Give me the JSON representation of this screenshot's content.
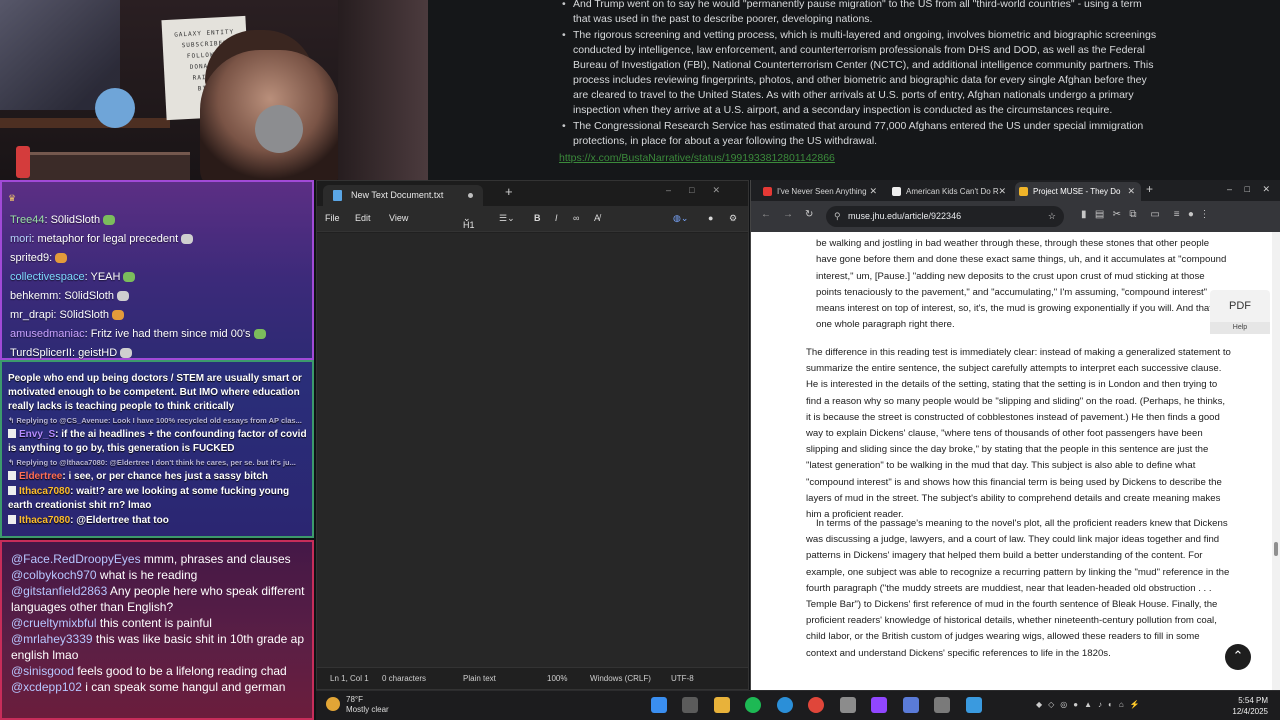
{
  "article_top": {
    "bullets": [
      "And Trump went on to say he would \"permanently pause migration\" to the US from all \"third-world countries\" - using a term that was used in the past to describe poorer, developing nations.",
      "The rigorous screening and vetting process, which is multi-layered and ongoing, involves biometric and biographic screenings conducted by intelligence, law enforcement, and counterterrorism professionals from DHS and DOD, as well as the Federal Bureau of Investigation (FBI), National Counterterrorism Center (NCTC), and additional intelligence community partners. This process includes reviewing fingerprints, photos, and other biometric and biographic data for every single Afghan before they are cleared to travel to the United States. As with other arrivals at U.S. ports of entry, Afghan nationals undergo a primary inspection when they arrive at a U.S. airport, and a secondary inspection is conducted as the circumstances require.",
      "The Congressional Research Service has estimated that around 77,000 Afghans entered the US under special immigration protections, in place for about a year following the US withdrawal."
    ],
    "link": "https://x.com/BustaNarrative/status/1991933812801142866"
  },
  "chat_top": [
    {
      "user": "Tree44",
      "text": ": S0lidSloth",
      "color": "#9be0a8"
    },
    {
      "user": "mori",
      "text": ": metaphor for legal precedent",
      "color": "#b9d5ff"
    },
    {
      "user": "sprited9",
      "text": ":",
      "color": "#ffffff"
    },
    {
      "user": "collectivespace",
      "text": ": YEAH",
      "color": "#7fd9ff"
    },
    {
      "user": "behkemm",
      "text": ": S0lidSloth",
      "color": "#ffffff"
    },
    {
      "user": "mr_drapi",
      "text": ": S0lidSloth",
      "color": "#ffffff"
    },
    {
      "user": "amusedmaniac",
      "text": ": Fritz ive had them since mid 00's",
      "color": "#c9a3ff"
    },
    {
      "user": "TurdSplicerII",
      "text": ": geistHD",
      "color": "#ffffff"
    }
  ],
  "chat_mid": {
    "first": "People who end up being doctors / STEM are usually smart or motivated enough to be competent. But IMO where education really lacks is teaching people to think critically",
    "reply1": "Replying to @CS_Avenue: Look I have 100% recycled old essays from AP clas...",
    "msg1_user": "Envy_S",
    "msg1_text": ": if the ai headlines + the confounding factor of covid is anything to go by, this generation is FUCKED",
    "reply2": "Replying to @lthaca7080: @Eldertree I don't think he cares, per se. but it's ju...",
    "msg2_user": "Eldertree",
    "msg2_text": ": i see, or per chance hes just a sassy bitch",
    "msg3_user": "Ithaca7080",
    "msg3_text": ": wait!? are we looking at some fucking young earth creationist shit rn? lmao",
    "msg4_user": "Ithaca7080",
    "msg4_text": ": @Eldertree that too"
  },
  "chat_bot": [
    {
      "user": "@Face.RedDroopyEyes",
      "text": " mmm, phrases and clauses"
    },
    {
      "user": "@colbykoch970",
      "text": " what is he reading"
    },
    {
      "user": "@gitstanfield2863",
      "text": " Any people here who speak different languages other than English?"
    },
    {
      "user": "@crueltymixbful",
      "text": " this content is painful"
    },
    {
      "user": "@mrlahey3339",
      "text": " this was like basic shit in 10th grade ap english lmao"
    },
    {
      "user": "@sinisgood",
      "text": " feels good to be a lifelong reading chad"
    },
    {
      "user": "@xcdepp102",
      "text": " i can speak some hangul and german"
    }
  ],
  "notepad": {
    "tab_title": "New Text Document.txt",
    "menu": {
      "file": "File",
      "edit": "Edit",
      "view": "View",
      "heading": "H1"
    },
    "status": {
      "position": "Ln 1, Col 1",
      "chars": "0 characters",
      "format": "Plain text",
      "zoom": "100%",
      "line_ending": "Windows (CRLF)",
      "encoding": "UTF-8"
    }
  },
  "browser": {
    "tabs": [
      {
        "title": "I've Never Seen Anything",
        "color": "#e53935"
      },
      {
        "title": "American Kids Can't Do R",
        "color": "#eeeeee"
      },
      {
        "title": "Project MUSE - They Do",
        "color": "#f0b429"
      }
    ],
    "url": "muse.jhu.edu/article/922346",
    "quote": "he's connecting that with the past and saying how they're just the latest generation of people to be walking and jostling in bad weather through these, through these stones that other people have gone before them and done these exact same things, uh, and it accumulates at \"compound interest,\" um, [Pause.] \"adding new deposits to the crust upon crust of mud sticking at those points tenaciously to the pavement,\" and \"accumulating,\" I'm assuming, \"compound interest\" means interest on top of interest, so, it's, the mud is growing exponentially if you will. And that's one whole paragraph right there.",
    "para1": "The difference in this reading test is immediately clear: instead of making a generalized statement to summarize the entire sentence, the subject carefully attempts to interpret each successive clause. He is interested in the details of the setting, stating that the setting is in London and then trying to find a reason why so many people would be \"slipping and sliding\" on the road. (Perhaps, he thinks, it is because the street is constructed of cobblestones instead of pavement.) He then finds a good way to explain Dickens' clause, \"where tens of thousands of other foot passengers have been slipping and sliding since the day broke,\" by stating that the people in this sentence are just the \"latest generation\" to be walking in the mud that day. This subject is also able to define what \"compound interest\" is and shows how this financial term is being used by Dickens to describe the layers of mud in the street. The subject's ability to comprehend details and create meaning makes him a proficient reader.",
    "para2": "In terms of the passage's meaning to the novel's plot, all the proficient readers knew that Dickens was discussing a judge, lawyers, and a court of law. They could link major ideas together and find patterns in Dickens' imagery that helped them build a better understanding of the content. For example, one subject was able to recognize a recurring pattern by linking the \"mud\" reference in the fourth paragraph (\"the muddy streets are muddiest, near that leaden-headed old obstruction . . . Temple Bar\") to Dickens' first reference of mud in the fourth sentence of Bleak House. Finally, the proficient readers' knowledge of historical details, whether nineteenth-century pollution from coal, child labor, or the British custom of judges wearing wigs, allowed these readers to fill in some context and understand Dickens' specific references to life in the 1820s.",
    "pdf_label": "PDF",
    "help_label": "Help"
  },
  "taskbar": {
    "temp": "78°F",
    "weather": "Mostly clear",
    "time": "5:54 PM",
    "date": "12/4/2025"
  },
  "webcam_poster": [
    "GALAXY ENTITY",
    "SUBSCRIBED",
    "FOLLOWED",
    "DONATED",
    "RAIDED",
    "BITS"
  ]
}
